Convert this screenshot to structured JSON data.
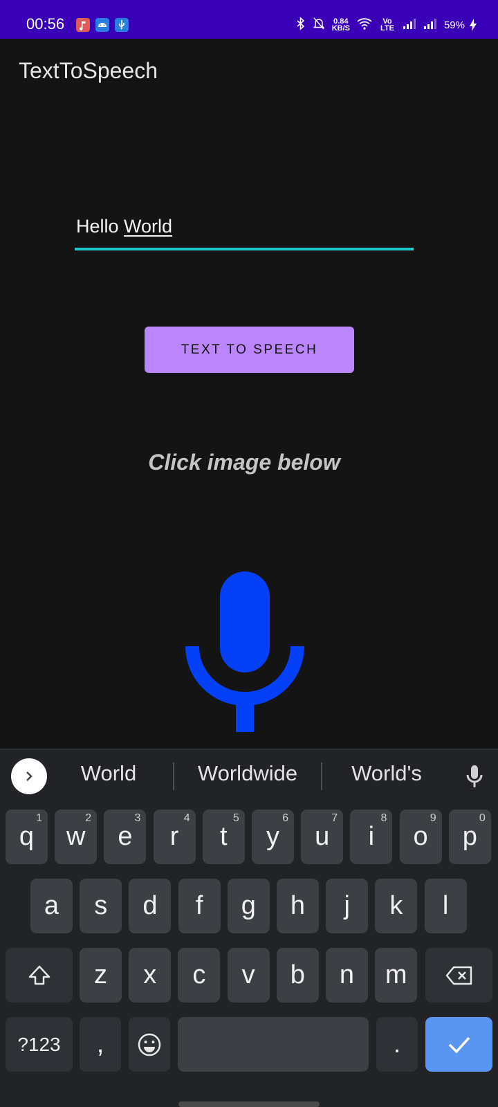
{
  "status_bar": {
    "time": "00:56",
    "net_speed_value": "0.84",
    "net_speed_unit": "KB/S",
    "volte": "Vo LTE",
    "battery": "59%"
  },
  "app": {
    "title": "TextToSpeech"
  },
  "input": {
    "text_plain": "Hello ",
    "text_underlined": "World"
  },
  "button": {
    "label": "TEXT TO SPEECH"
  },
  "hint": {
    "text": "Click image below"
  },
  "colors": {
    "status_bar": "#3a00b8",
    "accent_underline": "#1ec8c8",
    "button_bg": "#bb86fc",
    "mic_blue": "#0340f7",
    "enter_key": "#5b95f2"
  },
  "keyboard": {
    "suggestions": [
      "World",
      "Worldwide",
      "World's"
    ],
    "row1": [
      {
        "k": "q",
        "n": "1"
      },
      {
        "k": "w",
        "n": "2"
      },
      {
        "k": "e",
        "n": "3"
      },
      {
        "k": "r",
        "n": "4"
      },
      {
        "k": "t",
        "n": "5"
      },
      {
        "k": "y",
        "n": "6"
      },
      {
        "k": "u",
        "n": "7"
      },
      {
        "k": "i",
        "n": "8"
      },
      {
        "k": "o",
        "n": "9"
      },
      {
        "k": "p",
        "n": "0"
      }
    ],
    "row2": [
      "a",
      "s",
      "d",
      "f",
      "g",
      "h",
      "j",
      "k",
      "l"
    ],
    "row3": [
      "z",
      "x",
      "c",
      "v",
      "b",
      "n",
      "m"
    ],
    "symbols_label": "?123",
    "comma": ",",
    "period": "."
  }
}
